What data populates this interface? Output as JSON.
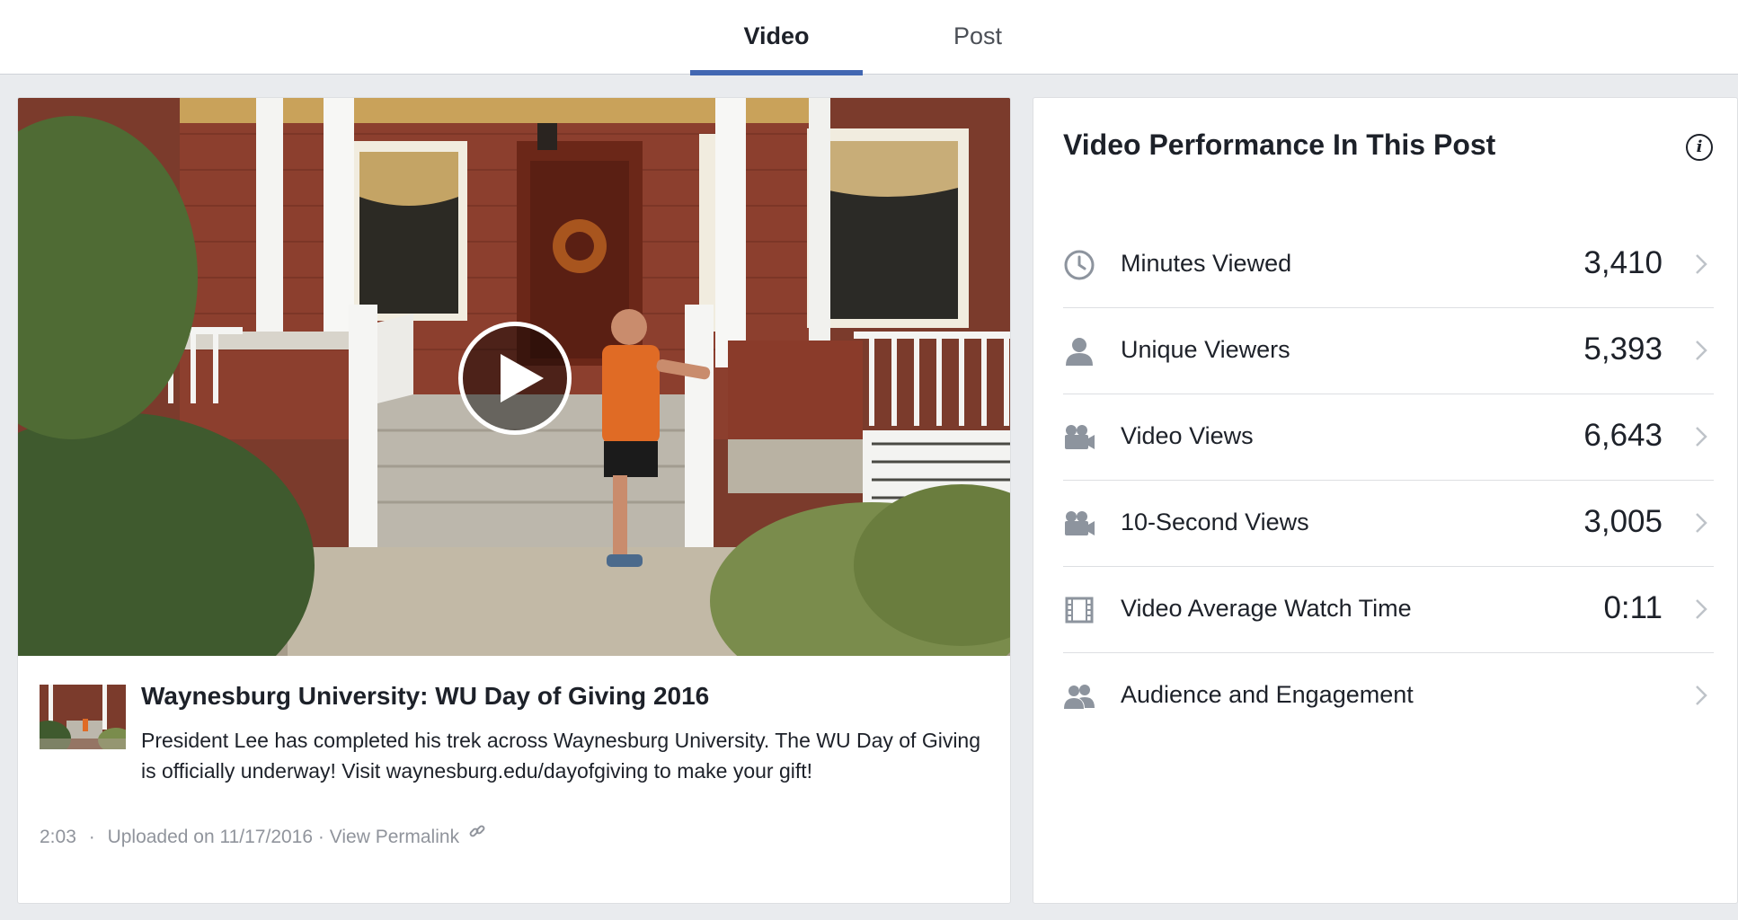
{
  "tabs": [
    {
      "label": "Video",
      "active": true
    },
    {
      "label": "Post",
      "active": false
    }
  ],
  "video": {
    "title": "Waynesburg University: WU Day of Giving 2016",
    "description": "President Lee has completed his trek across Waynesburg University. The WU Day of Giving is officially underway! Visit waynesburg.edu/dayofgiving to make your gift!",
    "duration": "2:03",
    "separator": "·",
    "uploaded": "Uploaded on 11/17/2016",
    "permalink_sep": "·",
    "permalink_label": "View Permalink",
    "play_icon": "play-icon",
    "link_icon": "link-icon"
  },
  "panel": {
    "title": "Video Performance In This Post",
    "info_icon": "info-icon",
    "info_glyph": "i",
    "metrics": [
      {
        "label": "Minutes Viewed",
        "value": "3,410",
        "icon": "clock-icon"
      },
      {
        "label": "Unique Viewers",
        "value": "5,393",
        "icon": "person-icon"
      },
      {
        "label": "Video Views",
        "value": "6,643",
        "icon": "video-camera-icon"
      },
      {
        "label": "10-Second Views",
        "value": "3,005",
        "icon": "video-camera-icon"
      },
      {
        "label": "Video Average Watch Time",
        "value": "0:11",
        "icon": "film-strip-icon"
      },
      {
        "label": "Audience and Engagement",
        "value": "",
        "icon": "people-icon"
      }
    ]
  },
  "colors": {
    "accent": "#4267b2",
    "background": "#e9ebee",
    "muted_text": "#90949c",
    "icon_gray": "#8d949e"
  }
}
